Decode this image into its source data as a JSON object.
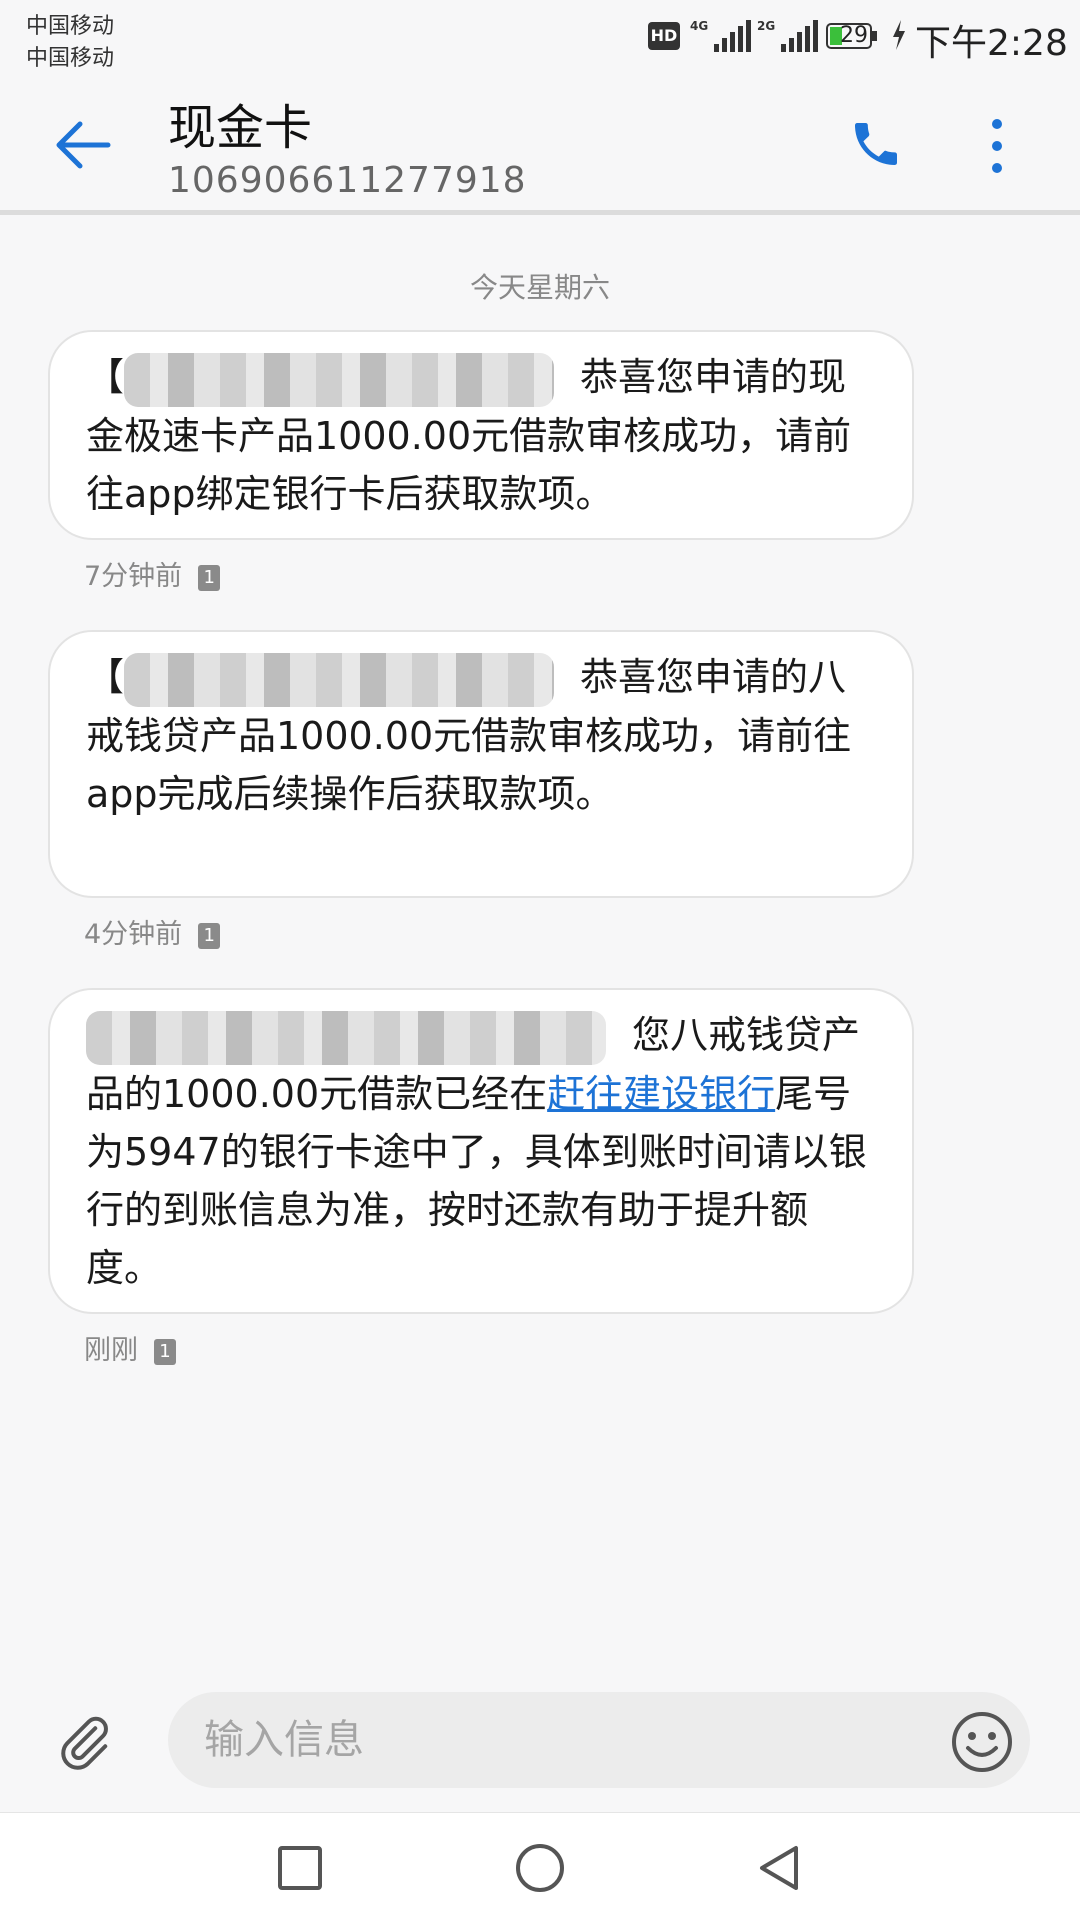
{
  "status_bar": {
    "carrier_1": "中国移动",
    "carrier_2": "中国移动",
    "hd_label": "HD",
    "network_1": "4G",
    "network_2": "2G",
    "battery": "29",
    "time": "下午2:28"
  },
  "header": {
    "title": "现金卡",
    "number": "106906611277918"
  },
  "date_separator": "今天星期六",
  "messages": [
    {
      "text_prefix": "【",
      "text_after_redaction": "恭喜您申请的现金极速卡产品1000.00元借款审核成功，请前往app绑定银行卡后获取款项。",
      "time": "7分钟前",
      "sim": "1"
    },
    {
      "text_prefix": "【",
      "text_after_redaction": "恭喜您申请的八戒钱贷产品1000.00元借款审核成功，请前往app完成后续操作后获取款项。",
      "time": "4分钟前",
      "sim": "1"
    },
    {
      "text_before_link": "您八戒钱贷产品的1000.00元借款已经在",
      "link_text": "赶往建设银行",
      "text_after_link": "尾号为5947的银行卡途中了，具体到账时间请以银行的到账信息为准，按时还款有助于提升额度。",
      "time": "刚刚",
      "sim": "1"
    }
  ],
  "input": {
    "placeholder": "输入信息",
    "value": ""
  },
  "colors": {
    "accent": "#1d73d6",
    "background": "#f7f7f8",
    "bubble": "#ffffff"
  },
  "icons": [
    "back-arrow-icon",
    "phone-icon",
    "more-vertical-icon",
    "paperclip-icon",
    "emoji-icon",
    "nav-square-icon",
    "nav-home-icon",
    "nav-back-icon"
  ]
}
